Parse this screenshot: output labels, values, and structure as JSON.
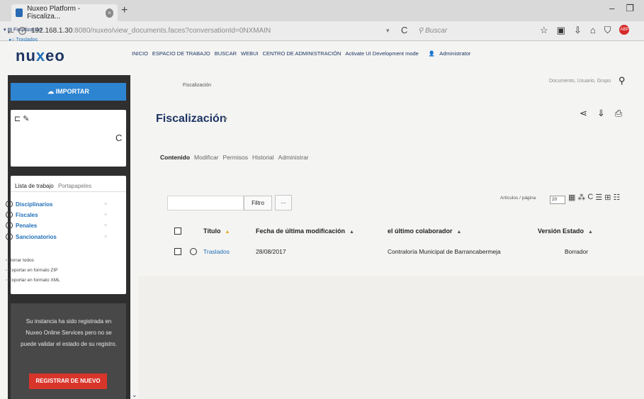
{
  "browser": {
    "tab_title": "Nuxeo Platform - Fiscaliza...",
    "url_host": "192.168.1.30",
    "url_path": ":8080/nuxeo/view_documents.faces?conversationId=0NXMAIN",
    "search_placeholder": "Buscar"
  },
  "app": {
    "logo_a": "nu",
    "logo_b": "x",
    "logo_c": "eo",
    "nav": [
      "INICIO",
      "ESPACIO DE TRABAJO",
      "BUSCAR",
      "WEBUI",
      "CENTRO DE ADMINISTRACIÓN",
      "Activate UI Development mode"
    ],
    "user": "Administrator"
  },
  "sidebar": {
    "import_label": "IMPORTAR",
    "tree": {
      "root": "Fiscalización",
      "child": "Traslados"
    },
    "worklist": {
      "tab_active": "Lista de trabajo",
      "tab_inactive": "Portapapeles",
      "items": [
        "Disciplinarios",
        "Fiscales",
        "Penales",
        "Sancionatorios"
      ],
      "actions": [
        "Borrar todos",
        "Exportar en formato ZIP",
        "Exportar en formato XML"
      ]
    },
    "notice": "Su instancia ha sido registrada en Nuxeo Online Services pero no se puede validar el estado de su registro.",
    "register_label": "REGISTRAR DE NUEVO"
  },
  "main": {
    "breadcrumb": "Fiscalización",
    "search_hint": "Documento, Usuario, Grupo",
    "title": "Fiscalización",
    "tabs": [
      "Contenido",
      "Modificar",
      "Permisos",
      "Historial",
      "Administrar"
    ],
    "filter_label": "Filtro",
    "more_label": "...",
    "perpage_label": "Artículos / página",
    "perpage_value": "20",
    "columns": {
      "title": "Título",
      "modified": "Fecha de última modificación",
      "contributor": "el último colaborador",
      "version": "Versión Estado"
    },
    "rows": [
      {
        "title": "Traslados",
        "modified": "28/08/2017",
        "contributor": "Contraloría Municipal de Barrancabermeja",
        "version": "Borrador"
      }
    ]
  }
}
